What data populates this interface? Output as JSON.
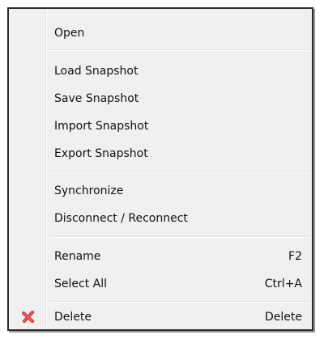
{
  "menu": {
    "open": "Open",
    "load_snapshot": "Load Snapshot",
    "save_snapshot": "Save Snapshot",
    "import_snapshot": "Import Snapshot",
    "export_snapshot": "Export Snapshot",
    "synchronize": "Synchronize",
    "disconnect_reconnect": "Disconnect / Reconnect",
    "rename": "Rename",
    "rename_shortcut": "F2",
    "select_all": "Select All",
    "select_all_shortcut": "Ctrl+A",
    "delete": "Delete",
    "delete_shortcut": "Delete",
    "delete_icon": "red-x-icon",
    "delete_icon_color": "#d92b2b"
  }
}
